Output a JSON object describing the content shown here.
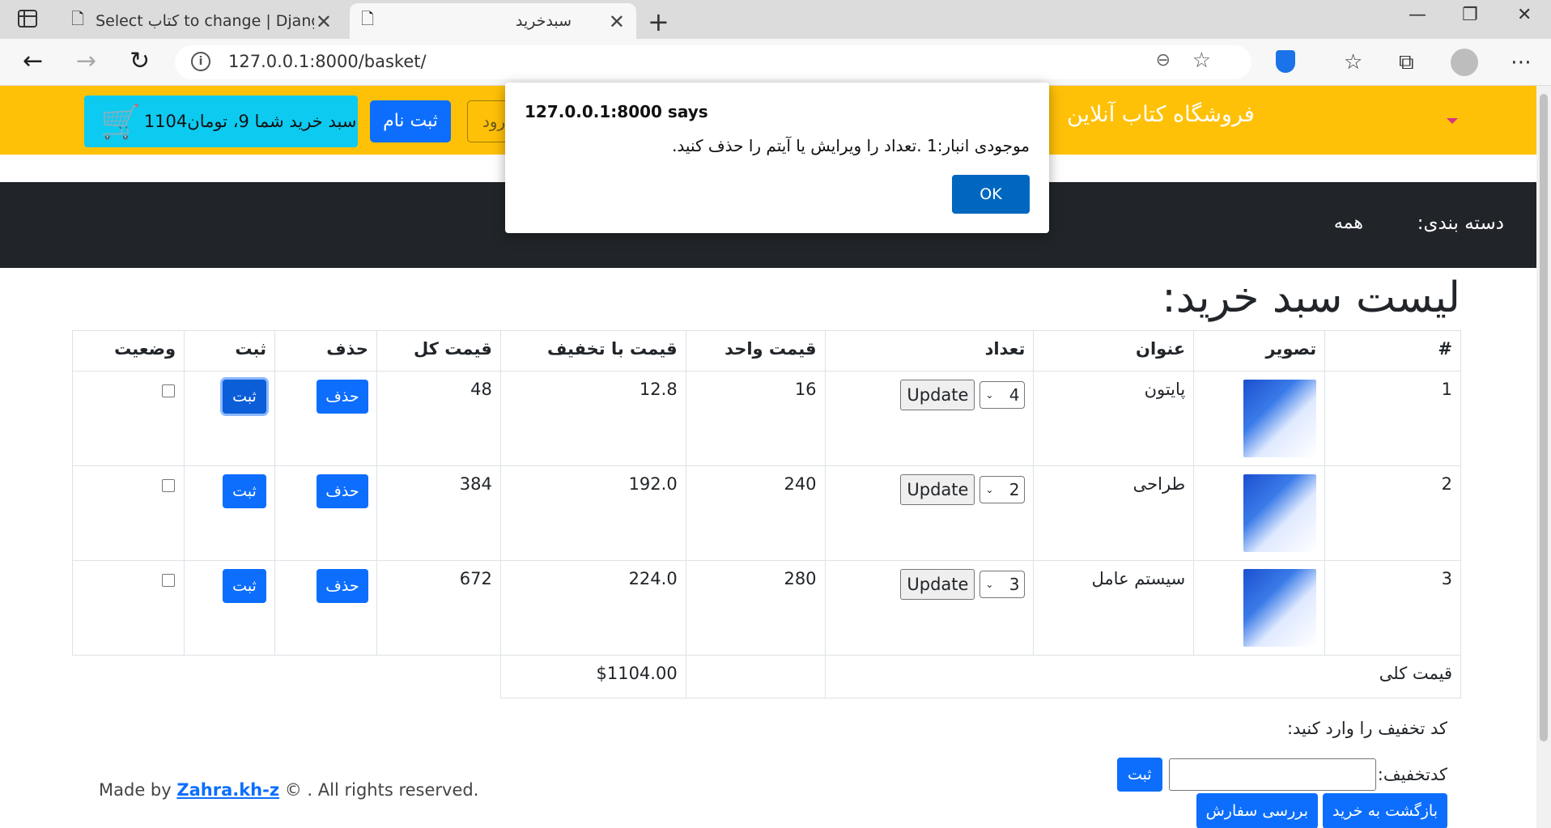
{
  "browser": {
    "tabs": [
      {
        "title": "Select کتاب to change | Django site admin"
      },
      {
        "title": "سبدخرید"
      }
    ],
    "url": "127.0.0.1:8000/basket/",
    "new_tab_symbol": "+",
    "tab_close_symbol": "✕"
  },
  "header": {
    "cart_label": "سبد خرید شما 9، تومان1104",
    "signup": "ثبت نام",
    "login_partial": "رود",
    "store_name": "فروشگاه کتاب آنلاین"
  },
  "nav": {
    "category_label": "دسته بندی:",
    "all": "همه"
  },
  "page": {
    "title": "لیست سبد خرید:"
  },
  "table": {
    "headers": [
      "#",
      "تصویر",
      "عنوان",
      "تعداد",
      "قیمت واحد",
      "قیمت با تخفیف",
      "قیمت کل",
      "حذف",
      "ثبت",
      "وضعیت"
    ],
    "rows": [
      {
        "num": "1",
        "title": "پایتون",
        "qty": "4",
        "unit": "16",
        "discounted": "12.8",
        "total": "48"
      },
      {
        "num": "2",
        "title": "طراحی",
        "qty": "2",
        "unit": "240",
        "discounted": "192.0",
        "total": "384"
      },
      {
        "num": "3",
        "title": "سیستم عامل",
        "qty": "3",
        "unit": "280",
        "discounted": "224.0",
        "total": "672"
      }
    ],
    "update_label": "Update",
    "delete_label": "حذف",
    "register_label": "ثبت",
    "total_label": "قیمت کلی",
    "grand_total": "$1104.00"
  },
  "coupon": {
    "prompt": "کد تخفیف را وارد کنید:",
    "field_label": "کدتخفیف:",
    "submit": "ثبت"
  },
  "actions": {
    "back": "بازگشت به خرید",
    "review": "بررسی سفارش"
  },
  "footer": {
    "prefix": "Made by ",
    "author": "Zahra.kh-z",
    "suffix": " © . All rights reserved."
  },
  "dialog": {
    "title": "127.0.0.1:8000 says",
    "message": "موجودی انبار:1 .تعداد را ویرایش یا آیتم را حذف کنید.",
    "ok": "OK"
  }
}
